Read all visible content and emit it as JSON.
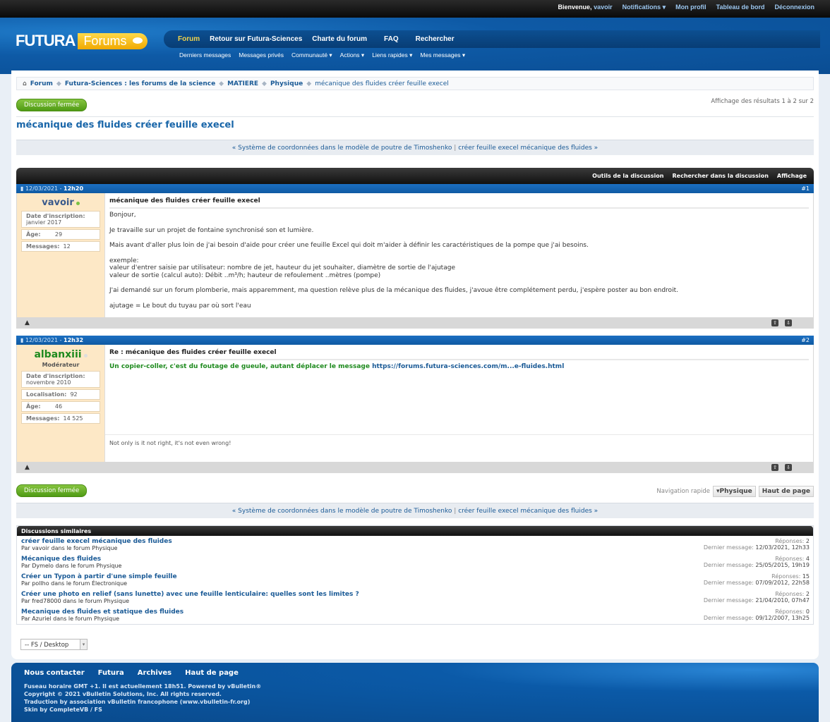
{
  "topbar": {
    "welcome": "Bienvenue,",
    "user": "vavoir",
    "links": [
      "Notifications ▾",
      "Mon profil",
      "Tableau de bord",
      "Déconnexion"
    ]
  },
  "logo": {
    "futura": "FUTURA",
    "forums": "Forums"
  },
  "nav": {
    "main": [
      "Forum",
      "Retour sur Futura-Sciences",
      "Charte du forum",
      "FAQ",
      "Rechercher"
    ],
    "sub": [
      "Derniers messages",
      "Messages privés",
      "Communauté ▾",
      "Actions ▾",
      "Liens rapides ▾",
      "Mes messages ▾"
    ]
  },
  "breadcrumb": [
    "Forum",
    "Futura-Sciences : les forums de la science",
    "MATIERE",
    "Physique",
    "mécanique des fluides créer feuille execel"
  ],
  "closed_label": "Discussion fermée",
  "results": "Affichage des résultats 1 à 2 sur 2",
  "title": "mécanique des fluides créer feuille execel",
  "prevnext": {
    "prev": "« Système de coordonnées dans le modèle de poutre de Timoshenko",
    "sep": "|",
    "next": "créer feuille execel mécanique des fluides »"
  },
  "tools": [
    "Outils de la discussion",
    "Rechercher dans la discussion",
    "Affichage"
  ],
  "posts": [
    {
      "date": "12/03/2021 -",
      "time": "12h20",
      "num": "#1",
      "user": "vavoir",
      "user_color": "#3a5a8c",
      "info": [
        [
          "Date d'inscription:",
          "janvier 2017"
        ],
        [
          "Âge:",
          "29"
        ],
        [
          "Messages:",
          "12"
        ]
      ],
      "title": "mécanique des fluides créer feuille execel",
      "body": [
        "Bonjour,",
        "Je travaille sur un projet de fontaine synchronisé son et lumière.",
        "Mais avant d'aller plus loin de j'ai besoin d'aide pour créer une feuille Excel qui doit m'aider à définir les caractéristiques de la pompe que j'ai besoins.",
        "exemple:\nvaleur d'entrer saisie par utilisateur: nombre de jet, hauteur du jet souhaiter, diamètre de sortie de l'ajutage\nvaleur de sortie (calcul auto): Débit ..m³/h; hauteur de refoulement ..mètres (pompe)",
        "J'ai demandé sur un forum plomberie, mais apparemment, ma question relève plus de la mécanique des fluides, j'avoue être complétement perdu, j'espère poster au bon endroit.",
        "ajutage = Le bout du tuyau par où sort l'eau"
      ]
    },
    {
      "date": "12/03/2021 -",
      "time": "12h32",
      "num": "#2",
      "user": "albanxiii",
      "user_color": "#1e8a1e",
      "role": "Modérateur",
      "info": [
        [
          "Date d'inscription:",
          "novembre 2010"
        ],
        [
          "Localisation:",
          "92"
        ],
        [
          "Âge:",
          "46"
        ],
        [
          "Messages:",
          "14 525"
        ]
      ],
      "title": "Re : mécanique des fluides créer feuille execel",
      "body_green": "Un copier-coller, c'est du foutage de gueule, autant déplacer le message",
      "body_link": "https://forums.futura-sciences.com/m...e-fluides.html",
      "signature": "Not only is it not right, it's not even wrong!"
    }
  ],
  "quicknav": {
    "label": "Navigation rapide",
    "forum": "▾Physique",
    "top": "Haut de page"
  },
  "similar": {
    "header": "Discussions similaires",
    "items": [
      {
        "title": "créer feuille execel mécanique des fluides",
        "by": "Par vavoir dans le forum Physique",
        "replies_label": "Réponses:",
        "replies": "2",
        "last_label": "Dernier message:",
        "last": "12/03/2021, 12h33"
      },
      {
        "title": "Mécanique des fluides",
        "by": "Par Dymelo dans le forum Physique",
        "replies_label": "Réponses:",
        "replies": "4",
        "last_label": "Dernier message:",
        "last": "25/05/2015, 19h19"
      },
      {
        "title": "Créer un Typon à partir d'une simple feuille",
        "by": "Par pollho dans le forum Électronique",
        "replies_label": "Réponses:",
        "replies": "15",
        "last_label": "Dernier message:",
        "last": "07/09/2012, 22h58"
      },
      {
        "title": "Créer une photo en relief (sans lunette) avec une feuille lenticulaire: quelles sont les limites ?",
        "by": "Par fred78000 dans le forum Physique",
        "replies_label": "Réponses:",
        "replies": "2",
        "last_label": "Dernier message:",
        "last": "21/04/2010, 07h47"
      },
      {
        "title": "Mecanique des fluides et statique des fluides",
        "by": "Par Azuriel dans le forum Physique",
        "replies_label": "Réponses:",
        "replies": "0",
        "last_label": "Dernier message:",
        "last": "09/12/2007, 13h25"
      }
    ]
  },
  "style_select": "-- FS / Desktop",
  "footer": {
    "links": [
      "Nous contacter",
      "Futura",
      "Archives",
      "Haut de page"
    ],
    "lines": [
      "Fuseau horaire GMT +1. Il est actuellement 18h51. Powered by vBulletin®",
      "Copyright © 2021 vBulletin Solutions, Inc. All rights reserved.",
      "Traduction by association vBulletin francophone (www.vbulletin-fr.org)",
      "Skin by CompleteVB / FS"
    ]
  }
}
